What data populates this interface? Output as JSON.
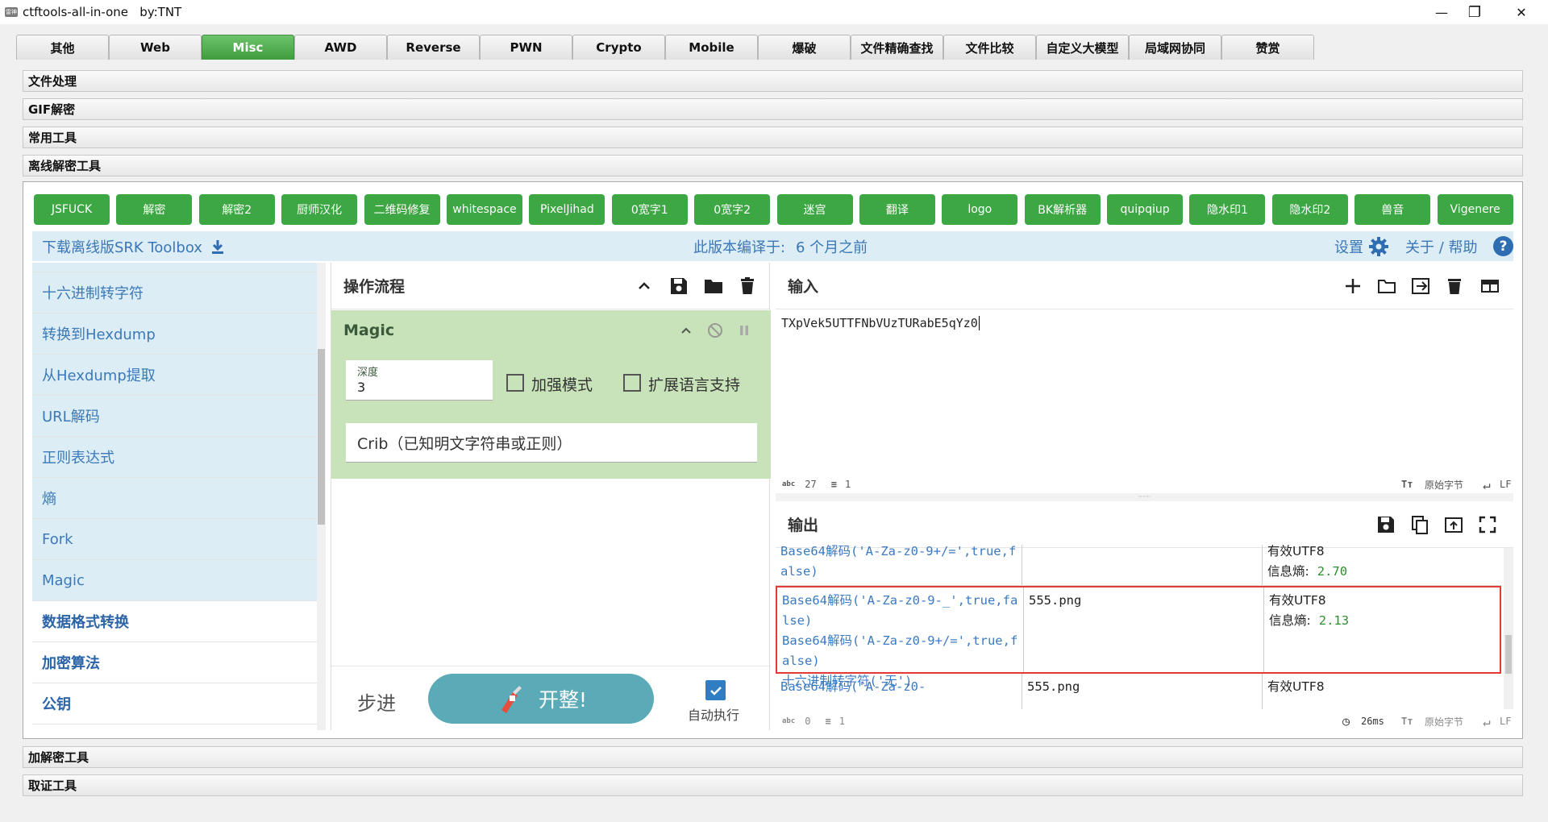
{
  "window": {
    "title": "ctftools-all-in-one   by:TNT",
    "icon_text": "雷神",
    "minimize": "—",
    "maximize": "❐",
    "close": "✕"
  },
  "tabs": [
    {
      "label": "其他"
    },
    {
      "label": "Web"
    },
    {
      "label": "Misc"
    },
    {
      "label": "AWD"
    },
    {
      "label": "Reverse"
    },
    {
      "label": "PWN"
    },
    {
      "label": "Crypto"
    },
    {
      "label": "Mobile"
    },
    {
      "label": "爆破"
    },
    {
      "label": "文件精确查找"
    },
    {
      "label": "文件比较"
    },
    {
      "label": "自定义大模型"
    },
    {
      "label": "局域网协同"
    },
    {
      "label": "赞赏"
    }
  ],
  "active_tab": "Misc",
  "accordion_top": [
    {
      "label": "文件处理"
    },
    {
      "label": "GIF解密"
    },
    {
      "label": "常用工具"
    },
    {
      "label": "离线解密工具"
    }
  ],
  "accordion_bottom": [
    {
      "label": "加解密工具"
    },
    {
      "label": "取证工具"
    }
  ],
  "tool_buttons": [
    {
      "label": "JSFUCK"
    },
    {
      "label": "解密"
    },
    {
      "label": "解密2"
    },
    {
      "label": "厨师汉化"
    },
    {
      "label": "二维码修复"
    },
    {
      "label": "whitespace"
    },
    {
      "label": "PixelJihad"
    },
    {
      "label": "0宽字1"
    },
    {
      "label": "0宽字2"
    },
    {
      "label": "迷宫"
    },
    {
      "label": "翻译"
    },
    {
      "label": "logo"
    },
    {
      "label": "BK解析器"
    },
    {
      "label": "quipqiup"
    },
    {
      "label": "隐水印1"
    },
    {
      "label": "隐水印2"
    },
    {
      "label": "兽音"
    },
    {
      "label": "Vigenere"
    }
  ],
  "infobar": {
    "download": "下载离线版SRK Toolbox",
    "compiled_label": "此版本编译于:",
    "compiled_value": "6 个月之前",
    "settings": "设置",
    "about": "关于 / 帮助"
  },
  "sidebar": {
    "items": [
      {
        "label": "十六进制转字符",
        "cat": false
      },
      {
        "label": "转换到Hexdump",
        "cat": false
      },
      {
        "label": "从Hexdump提取",
        "cat": false
      },
      {
        "label": "URL解码",
        "cat": false
      },
      {
        "label": "正则表达式",
        "cat": false
      },
      {
        "label": "熵",
        "cat": false
      },
      {
        "label": "Fork",
        "cat": false
      },
      {
        "label": "Magic",
        "cat": false
      },
      {
        "label": "数据格式转换",
        "cat": true
      },
      {
        "label": "加密算法",
        "cat": true
      },
      {
        "label": "公钥",
        "cat": true
      }
    ]
  },
  "recipe": {
    "title": "操作流程",
    "op_name": "Magic",
    "depth_label": "深度",
    "depth_value": "3",
    "intensive_label": "加强模式",
    "extensive_label": "扩展语言支持",
    "crib_placeholder": "Crib（已知明文字符串或正则）",
    "step_label": "步进",
    "bake_label": "开整!",
    "auto_label": "自动执行",
    "auto_checked": true
  },
  "input": {
    "title": "输入",
    "value": "TXpVek5UTTFNbVUzTURabE5qYz0",
    "status_chars_label": "abc",
    "status_chars": "27",
    "status_lines": "1",
    "raw_bytes": "原始字节",
    "eol": "LF"
  },
  "output": {
    "title": "输出",
    "rows": [
      {
        "recipe": "Base64解码('A-Za-z0-9+/=',true,false)",
        "result": "",
        "props": "有效UTF8",
        "entropy_label": "信息熵:",
        "entropy": "2.70"
      },
      {
        "recipe": "Base64解码('A-Za-z0-9-_',true,false)\nBase64解码('A-Za-z0-9+/=',true,false)\n十六进制转字符('无')",
        "result": "555.png",
        "props": "有效UTF8",
        "entropy_label": "信息熵:",
        "entropy": "2.13"
      },
      {
        "recipe": "Base64解码('A-Za-z0-",
        "result": "555.png",
        "props": "有效UTF8",
        "entropy_label": "",
        "entropy": ""
      }
    ],
    "status_chars_label": "abc",
    "status_chars": "0",
    "status_lines": "1",
    "time": "26ms",
    "raw_bytes": "原始字节",
    "eol": "LF"
  },
  "colors": {
    "accent_green": "#3ca743",
    "link_blue": "#3b77b6",
    "highlight_red": "#e53935",
    "magic_bg": "#c8e2b9",
    "bake_btn": "#5aaab8"
  }
}
